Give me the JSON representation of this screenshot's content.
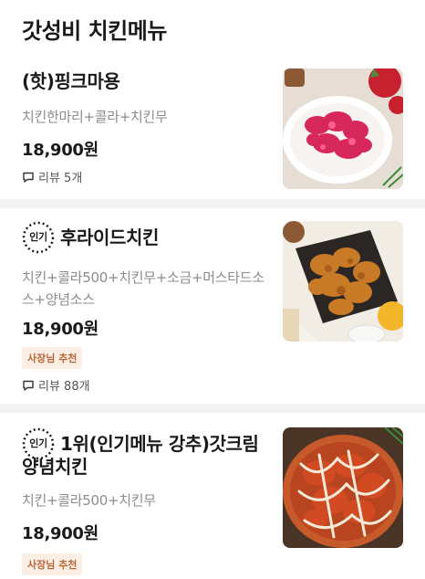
{
  "section_title": "갓성비 치킨메뉴",
  "items": [
    {
      "name": "(핫)핑크마용",
      "description": "치킨한마리+콜라+치킨무",
      "price": "18,900원",
      "review": "리뷰 5개",
      "photo_icon": "pink-chicken-photo"
    },
    {
      "popular_label": "인기",
      "name": "후라이드치킨",
      "description": "치킨+콜라500+치킨무+소금+머스타드소스+양념소스",
      "price": "18,900원",
      "badge": "사장님 추천",
      "review": "리뷰 88개",
      "photo_icon": "fried-chicken-photo"
    },
    {
      "popular_label": "인기",
      "name_line1": "1위(인기메뉴 강추)갓크림",
      "name_line2": "양념치킨",
      "description": "치킨+콜라500+치킨무",
      "price": "18,900원",
      "badge": "사장님 추천",
      "photo_icon": "cream-yangnyeom-chicken-photo"
    }
  ],
  "colors": {
    "badge_bg": "#fbeee4",
    "badge_text": "#b7683a",
    "divider": "#f2f2f2",
    "desc_text": "#8c8c8c"
  }
}
